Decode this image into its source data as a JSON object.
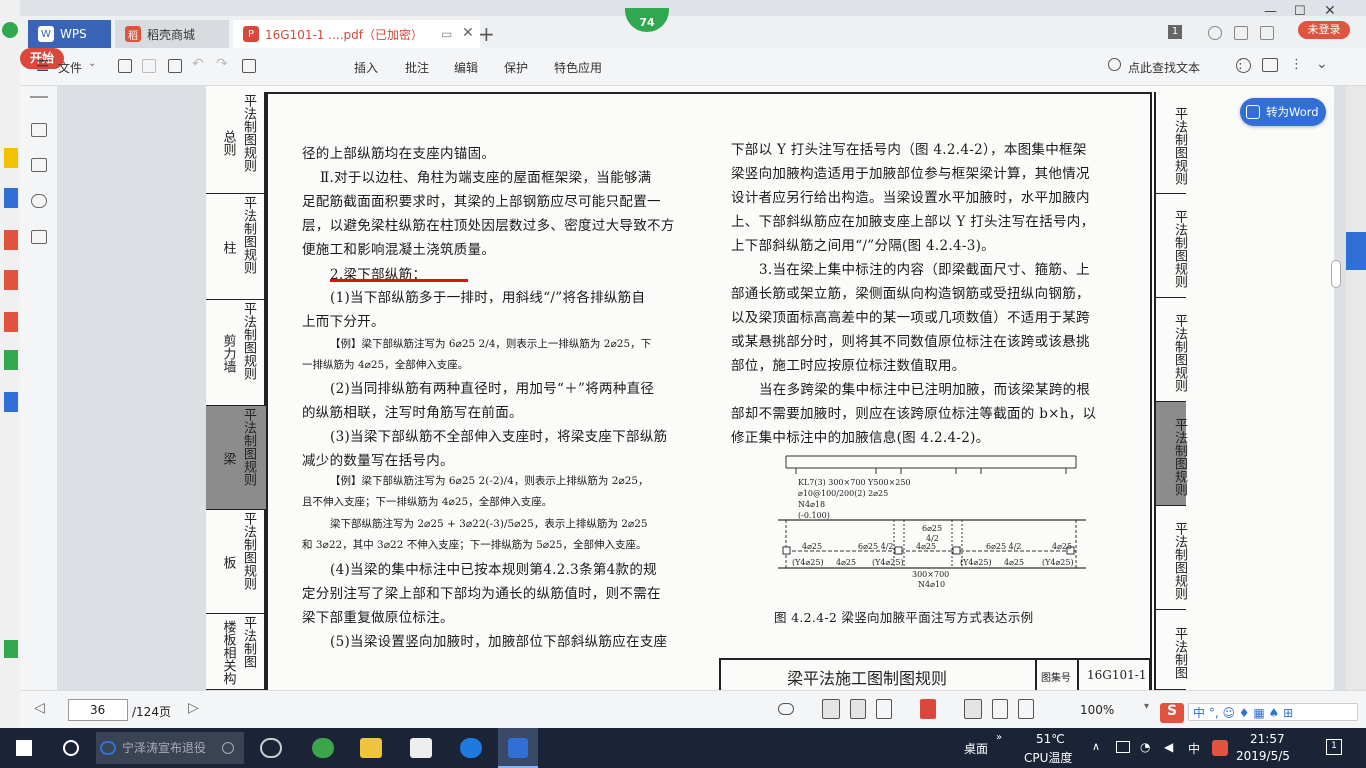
{
  "tabs": {
    "wps": "WPS",
    "shop": "稻壳商城",
    "pdf": "16G101-1 ....pdf（已加密）"
  },
  "badge": "74",
  "login": "未登录",
  "toolbar": {
    "file": "文件",
    "start": "开始",
    "insert": "插入",
    "annotate": "批注",
    "edit": "编辑",
    "protect": "保护",
    "special": "特色应用",
    "search": "点此查找文本"
  },
  "convert": "转为Word",
  "left_sections": [
    {
      "big": "总则",
      "small": "平法制图规则"
    },
    {
      "big": "柱",
      "small": "平法制图规则"
    },
    {
      "big": "剪力墙",
      "small": "平法制图规则"
    },
    {
      "big": "梁",
      "small": "平法制图规则"
    },
    {
      "big": "板",
      "small": "平法制图规则"
    },
    {
      "big": "楼板相关构",
      "small": "平法制图"
    }
  ],
  "right_sections": [
    "平法制图规则",
    "平法制图规则",
    "平法制图规则",
    "平法制图规则",
    "平法制图规则",
    "平法制图"
  ],
  "left_text": {
    "l1": "径的上部纵筋均在支座内锚固。",
    "l2": "Ⅱ.对于以边柱、角柱为端支座的屋面框架梁，当能够满",
    "l3": "足配筋截面面积要求时，其梁的上部钢筋应尽可能只配置一",
    "l4": "层，以避免梁柱纵筋在柱顶处因层数过多、密度过大导致不方",
    "l5": "便施工和影响混凝土浇筑质量。",
    "l6": "2.梁下部纵筋：",
    "l7": "(1)当下部纵筋多于一排时，用斜线“/”将各排纵筋自",
    "l8": "上而下分开。",
    "l9": "【例】梁下部纵筋注写为 6⌀25 2/4，则表示上一排纵筋为 2⌀25，下",
    "l10": "一排纵筋为 4⌀25，全部伸入支座。",
    "l11": "(2)当同排纵筋有两种直径时，用加号“＋”将两种直径",
    "l12": "的纵筋相联，注写时角筋写在前面。",
    "l13": "(3)当梁下部纵筋不全部伸入支座时，将梁支座下部纵筋",
    "l14": "减少的数量写在括号内。",
    "l15": "【例】梁下部纵筋注写为 6⌀25 2(-2)/4，则表示上排纵筋为 2⌀25，",
    "l16": "且不伸入支座；下一排纵筋为 4⌀25，全部伸入支座。",
    "l17": "梁下部纵筋注写为 2⌀25 + 3⌀22(-3)/5⌀25，表示上排纵筋为 2⌀25",
    "l18": "和 3⌀22，其中 3⌀22 不伸入支座；下一排纵筋为 5⌀25，全部伸入支座。",
    "l19": "(4)当梁的集中标注中已按本规则第4.2.3条第4款的规",
    "l20": "定分别注写了梁上部和下部均为通长的纵筋值时，则不需在",
    "l21": "梁下部重复做原位标注。",
    "l22": "(5)当梁设置竖向加腋时，加腋部位下部斜纵筋应在支座"
  },
  "right_text": {
    "r1": "下部以 Y 打头注写在括号内（图 4.2.4-2），本图集中框架",
    "r2": "梁竖向加腋构造适用于加腋部位参与框架梁计算，其他情况",
    "r3": "设计者应另行给出构造。当梁设置水平加腋时，水平加腋内",
    "r4": "上、下部斜纵筋应在加腋支座上部以 Y 打头注写在括号内，",
    "r5": "上下部斜纵筋之间用“/”分隔(图 4.2.4-3)。",
    "r6": "3.当在梁上集中标注的内容（即梁截面尺寸、箍筋、上",
    "r7": "部通长筋或架立筋，梁侧面纵向构造钢筋或受扭纵向钢筋，",
    "r8": "以及梁顶面标高高差中的某一项或几项数值）不适用于某跨",
    "r9": "或某悬挑部分时，则将其不同数值原位标注在该跨或该悬挑",
    "r10": "部位，施工时应按原位标注数值取用。",
    "r11": "当在多跨梁的集中标注中已注明加腋，而该梁某跨的根",
    "r12": "部却不需要加腋时，则应在该跨原位标注等截面的 b×h，以",
    "r13": "修正集中标注中的加腋信息(图 4.2.4-2)。"
  },
  "figure": {
    "t1": "KL7(3)  300×700  Y500×250",
    "t2": "⌀10@100/200(2)  2⌀25",
    "t3": "N4⌀18",
    "t4": "(-0.100)",
    "t5": "6⌀25",
    "t6": "4/2",
    "t7": "4⌀25",
    "t8": "6⌀25  4/2",
    "t9": "4⌀25",
    "t10": "6⌀25  4/2",
    "t11": "4⌀25",
    "t12": "(Y4⌀25)",
    "t13": "4⌀25",
    "t14": "(Y4⌀25)",
    "t15": "300×700",
    "t16": "N4⌀10",
    "t17": "(Y4⌀25)",
    "t18": "4⌀25",
    "t19": "(Y4⌀25)",
    "caption": "图 4.2.4-2  梁竖向加腋平面注写方式表达示例"
  },
  "titleblock": {
    "title": "梁平法施工图制图规则",
    "label": "图集号",
    "code": "16G101-1"
  },
  "status": {
    "page": "36",
    "total": "/124页",
    "zoom": "100%"
  },
  "taskbar": {
    "search": "宁泽涛宣布退役",
    "desktop": "桌面",
    "temp": "51℃",
    "cpu": "CPU温度",
    "ime": "中",
    "time": "21:57",
    "date": "2019/5/5",
    "notify": "1"
  },
  "colors": {
    "accent_red": "#d9483b",
    "accent_blue": "#2f6fd6"
  }
}
